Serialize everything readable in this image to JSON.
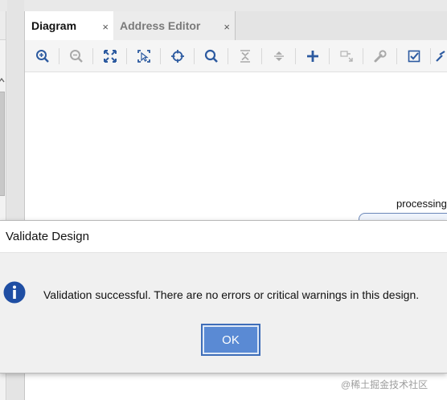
{
  "tabs": [
    {
      "label": "Diagram",
      "close": "×"
    },
    {
      "label": "Address Editor",
      "close": "×"
    }
  ],
  "toolbar": {
    "buttons": [
      "zoom-in-icon",
      "zoom-out-icon",
      "fit-view-icon",
      "zoom-fit-selection-icon",
      "auto-connect-icon",
      "search-icon",
      "collapse-all-icon",
      "expand-all-icon",
      "add-ip-icon",
      "make-external-icon",
      "properties-wrench-icon",
      "validate-design-icon",
      "more-icon"
    ]
  },
  "canvas": {
    "block_label": "processing"
  },
  "dialog": {
    "title": "Validate Design",
    "message": "Validation successful. There are no errors or critical warnings in this design.",
    "ok_label": "OK"
  },
  "watermark": "@稀土掘金技术社区",
  "colors": {
    "accent": "#5a8ad4",
    "info_icon": "#1f4ea3",
    "toolbar_icon": "#2c5aa0"
  }
}
